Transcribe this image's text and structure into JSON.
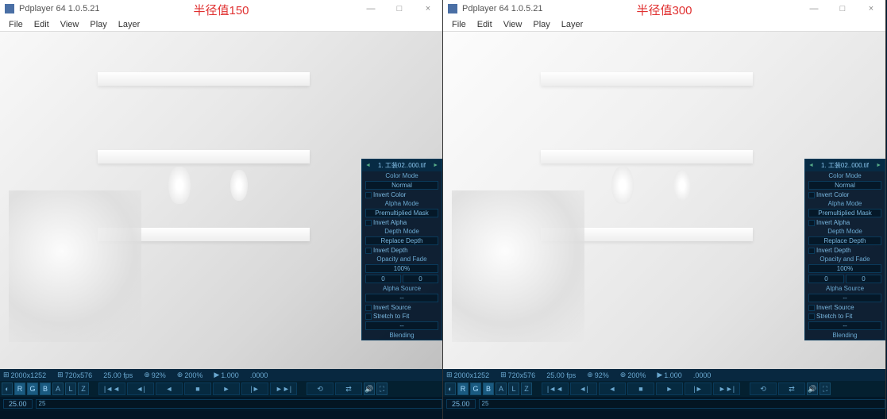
{
  "left": {
    "app_title": "Pdplayer 64 1.0.5.21",
    "annotation": "半径值150",
    "menus": [
      "File",
      "Edit",
      "View",
      "Play",
      "Layer"
    ],
    "win": {
      "min": "—",
      "max": "□",
      "close": "×"
    },
    "panel": {
      "layer_name": "1. 工装02..000.tif",
      "color_mode_label": "Color Mode",
      "color_mode": "Normal",
      "invert_color": "Invert Color",
      "alpha_mode_label": "Alpha Mode",
      "alpha_mode": "Premultiplied Mask",
      "invert_alpha": "Invert Alpha",
      "depth_mode_label": "Depth Mode",
      "depth_mode": "Replace Depth",
      "invert_depth": "Invert Depth",
      "opacity_fade_label": "Opacity and Fade",
      "opacity": "100%",
      "fade_a": "0",
      "fade_b": "0",
      "alpha_source_label": "Alpha Source",
      "alpha_source": "--",
      "invert_source": "Invert Source",
      "stretch_to_fit": "Stretch to Fit",
      "dash": "--",
      "blending_label": "Blending"
    },
    "status": {
      "res1": "2000x1252",
      "res2": "720x576",
      "fps": "25.00 fps",
      "zoom": "92%",
      "scale": "200%",
      "lvl": "1.000",
      "frame": ".0000"
    },
    "channels": {
      "r": "R",
      "g": "G",
      "b": "B",
      "a": "A",
      "l": "L",
      "z": "Z"
    },
    "timeline": {
      "start": "25.00",
      "mark": "25"
    }
  },
  "right": {
    "app_title": "Pdplayer 64 1.0.5.21",
    "annotation": "半径值300",
    "menus": [
      "File",
      "Edit",
      "View",
      "Play",
      "Layer"
    ],
    "win": {
      "min": "—",
      "max": "□",
      "close": "×"
    },
    "panel": {
      "layer_name": "1. 工装02..000.tif",
      "color_mode_label": "Color Mode",
      "color_mode": "Normal",
      "invert_color": "Invert Color",
      "alpha_mode_label": "Alpha Mode",
      "alpha_mode": "Premultiplied Mask",
      "invert_alpha": "Invert Alpha",
      "depth_mode_label": "Depth Mode",
      "depth_mode": "Replace Depth",
      "invert_depth": "Invert Depth",
      "opacity_fade_label": "Opacity and Fade",
      "opacity": "100%",
      "fade_a": "0",
      "fade_b": "0",
      "alpha_source_label": "Alpha Source",
      "alpha_source": "--",
      "invert_source": "Invert Source",
      "stretch_to_fit": "Stretch to Fit",
      "dash": "--",
      "blending_label": "Blending"
    },
    "status": {
      "res1": "2000x1252",
      "res2": "720x576",
      "fps": "25.00 fps",
      "zoom": "92%",
      "scale": "200%",
      "lvl": "1.000",
      "frame": ".0000"
    },
    "channels": {
      "r": "R",
      "g": "G",
      "b": "B",
      "a": "A",
      "l": "L",
      "z": "Z"
    },
    "timeline": {
      "start": "25.00",
      "mark": "25"
    }
  }
}
